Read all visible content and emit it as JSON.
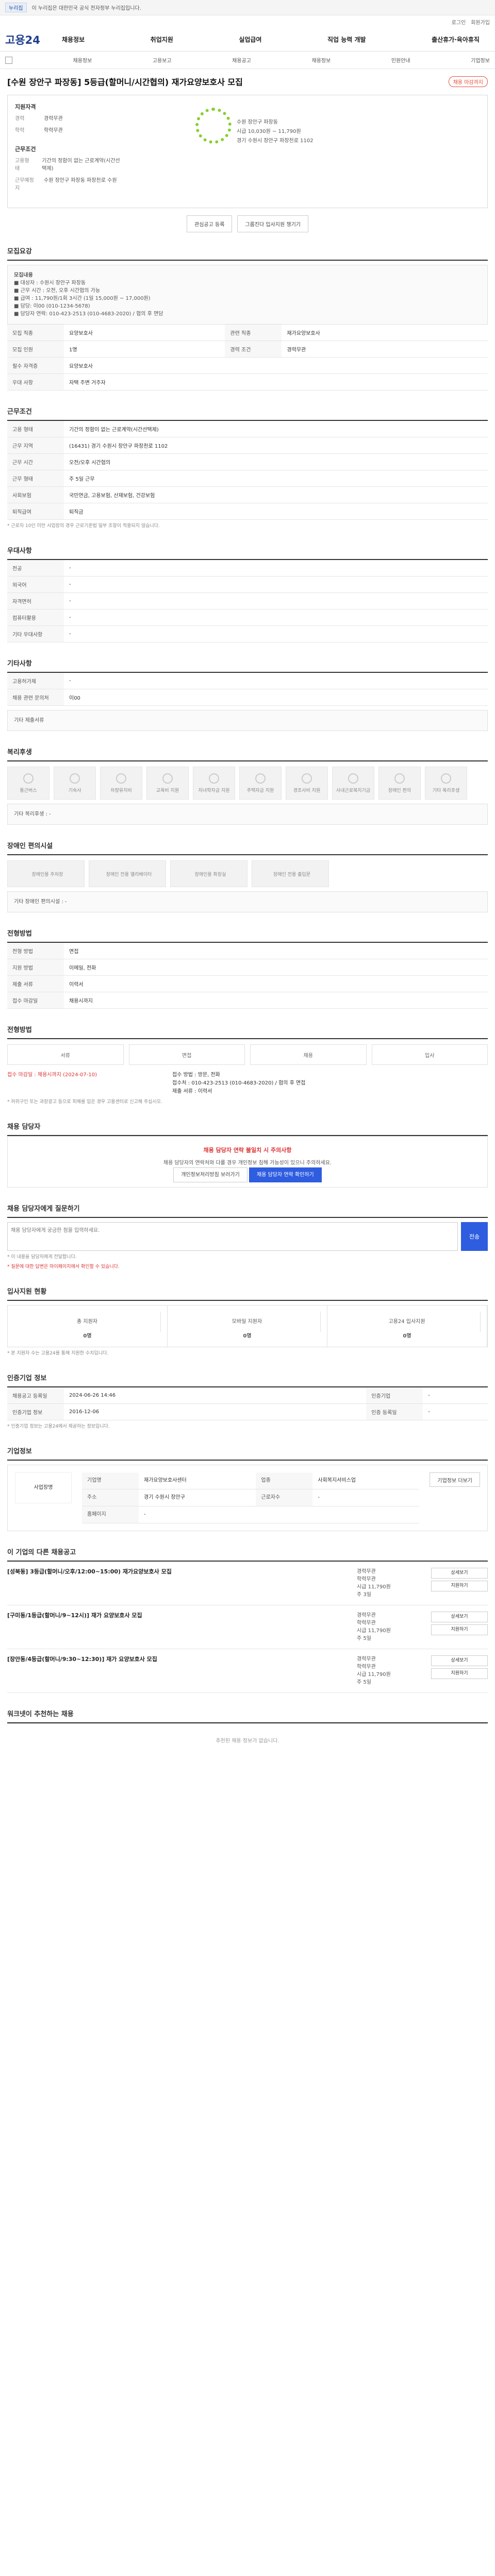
{
  "gov": {
    "text": "이 누리집은 대한민국 공식 전자정부 누리집입니다.",
    "tag": "누리집"
  },
  "util": [
    "로그인",
    "회원가입"
  ],
  "brand": "고용24",
  "nav": [
    "채용정보",
    "취업지원",
    "실업급여",
    "직업 능력 개발",
    "출산휴가·육아휴직"
  ],
  "subnav": [
    "채용정보",
    "고용보고",
    "채용공고",
    "채용정보",
    "민원안내",
    "기업정보"
  ],
  "title": "[수원 장안구 파장동] 5등급(할머니/시간협의) 재가요양보호사 모집",
  "badge": "채용 마감까지",
  "summary": {
    "recruit_title": "지원자격",
    "rows": [
      [
        "경력",
        "경력무관"
      ],
      [
        "학력",
        "학력무관"
      ]
    ],
    "cond_title": "근무조건",
    "cond": [
      [
        "고용형태",
        "기간의 정함이 없는 근로계약(시간선택제)"
      ],
      [
        "근무예정지",
        "수원 장안구 파장동 파장천로 수원"
      ]
    ],
    "company": "수원 장안구 파장동",
    "pay": "시급 10,030원 ~ 11,790원",
    "loc": "경기 수원시 장안구 파장천로 1102"
  },
  "actions": [
    "관심공고 등록",
    "그룹진다 입사지원 챙기기"
  ],
  "sec1": {
    "title": "모집요강",
    "box": [
      "모집내용",
      "■ 대상자 : 수원시 장안구 파장동",
      "■ 근무 시간 : 오전, 오후 시간협의 가능",
      "■ 급여 : 11,790원/1회 3시간 (1일 15,000원 ~ 17,000원)",
      "■ 담당: 이00 (010-1234-5678)",
      "■ 담당자 연락: 010-423-2513 (010-4683-2020) / 협의 후 면담"
    ],
    "rows": [
      [
        "모집 직종",
        "요양보호사",
        "관련 직종",
        "재가요양보호사"
      ],
      [
        "모집 인원",
        "1명",
        "경력 조건",
        "경력무관"
      ],
      [
        "필수 자격증",
        "요양보호사",
        "",
        ""
      ],
      [
        "우대 사항",
        "자택 주변 거주자",
        "",
        ""
      ]
    ]
  },
  "sec2": {
    "title": "근무조건",
    "rows": [
      [
        "고용 형태",
        "기간의 정함이 없는 근로계약(시간선택제)"
      ],
      [
        "근무 지역",
        "(16431) 경기 수원시 장안구 파장천로 1102"
      ],
      [
        "근무 시간",
        "오전/오후 시간협의"
      ],
      [
        "근무 형태",
        "주 5일 근무"
      ],
      [
        "사회보험",
        "국민연금, 고용보험, 산재보험, 건강보험"
      ],
      [
        "퇴직급여",
        "퇴직금"
      ]
    ],
    "note": "* 근로자 10인 미만 사업장의 경우 근로기준법 일부 조항이 적용되지 않습니다."
  },
  "sec3": {
    "title": "우대사항",
    "rows": [
      [
        "전공",
        "-"
      ],
      [
        "외국어",
        "-"
      ],
      [
        "자격면허",
        "-"
      ],
      [
        "컴퓨터활용",
        "-"
      ],
      [
        "기타 우대사항",
        "-"
      ]
    ]
  },
  "sec4": {
    "title": "기타사항",
    "rows": [
      [
        "고용허가제",
        "-"
      ],
      [
        "채용 관련 문의처",
        "이00"
      ]
    ],
    "extra": "기타 제출서류"
  },
  "sec5": {
    "title": "복리후생",
    "items": [
      "통근버스",
      "기숙사",
      "차량유지비",
      "교육비 지원",
      "자녀학자금 지원",
      "주택자금 지원",
      "경조사비 지원",
      "사내근로복지기금",
      "장애인 편의",
      "기타 복리후생"
    ],
    "etc": "기타 복리후생 : -"
  },
  "sec6": {
    "title": "장애인 편의시설",
    "items": [
      "장애인용 주차장",
      "장애인 전용 엘리베이터",
      "장애인용 화장실",
      "장애인 전용 출입문"
    ],
    "etc": "기타 장애인 편의시설 : -"
  },
  "sec7": {
    "title": "전형방법",
    "rows": [
      [
        "전형 방법",
        "면접"
      ],
      [
        "지원 방법",
        "이메일, 전화"
      ],
      [
        "제출 서류",
        "이력서"
      ],
      [
        "접수 마감일",
        "채용시까지"
      ]
    ]
  },
  "sec8": {
    "title": "전형방법",
    "steps": [
      "서류",
      "면접",
      "채용",
      "입사"
    ],
    "apply_left": "접수 마감일 : 채용시까지 (2024-07-10)",
    "apply_right": [
      "접수 방법 : 방문, 전화",
      "접수처 : 010-423-2513 (010-4683-2020) / 협의 후 면접",
      "제출 서류 : 이력서"
    ],
    "note": "* 허위구인 또는 과장광고 등으로 피해를 입은 경우 고용센터로 신고해 주십시오."
  },
  "sec9": {
    "title": "채용 담당자",
    "warn": "채용 담당자 연락 불일치 시 주의사항",
    "desc": "채용 담당자의 연락처와 다를 경우 개인정보 침해 가능성이 있으니 주의하세요.",
    "btns": [
      "개인정보처리방침 보러가기",
      "채용 담당자 연락 확인하기"
    ]
  },
  "sec10": {
    "title": "채용 담당자에게 질문하기",
    "placeholder": "채용 담당자에게 궁금한 점을 입력하세요.",
    "send": "전송",
    "notes": [
      "* 이 내용을 담당자에게 전달합니다.",
      "* 질문에 대한 답변은 마이페이지에서 확인할 수 있습니다."
    ]
  },
  "sec11": {
    "title": "입사지원 현황",
    "stats": [
      [
        "총 지원자",
        "0명"
      ],
      [
        "모바일 지원자",
        "0명"
      ],
      [
        "고용24 입사지원",
        "0명"
      ]
    ],
    "note": "* 본 지원자 수는 고용24를 통해 지원한 수치입니다."
  },
  "sec12": {
    "title": "인증기업 정보",
    "rows": [
      [
        "채용공고 등록일",
        "2024-06-26 14:46",
        "인증기업",
        "-"
      ],
      [
        "인증기업 정보",
        "2016-12-06",
        "인증 등록일",
        "-"
      ]
    ],
    "note": "* 인증기업 정보는 고용24에서 제공하는 정보입니다."
  },
  "sec13": {
    "title": "기업정보",
    "name": "사업장명",
    "rows": [
      [
        "기업명",
        "재가요양보호사센터",
        "업종",
        "사회복지서비스업"
      ],
      [
        "주소",
        "경기 수원시 장안구",
        "근로자수",
        "-"
      ],
      [
        "홈페이지",
        "-",
        "",
        ""
      ]
    ],
    "btn": "기업정보 더보기"
  },
  "sec14": {
    "title": "이 기업의 다른 채용공고",
    "jobs": [
      {
        "title": "[성북동] 3등급(할머니/오후/12:00~15:00) 재가요양보호사 모집",
        "c": [
          "경력무관",
          "학력무관",
          "시급 11,790원",
          "주 3일"
        ]
      },
      {
        "title": "[구미동/1등급(할머니/9~12시)] 재가 요양보호사 모집",
        "c": [
          "경력무관",
          "학력무관",
          "시급 11,790원",
          "주 5일"
        ]
      },
      {
        "title": "[장안동/4등급(할머니/9:30~12:30)] 재가 요양보호사 모집",
        "c": [
          "경력무관",
          "학력무관",
          "시급 11,790원",
          "주 5일"
        ]
      }
    ],
    "act": [
      "상세보기",
      "지원하기"
    ]
  },
  "sec15": {
    "title": "워크넷이 추천하는 채용",
    "empty": "추천된 채용 정보가 없습니다."
  },
  "colors": {
    "brand": "#1f3f8f",
    "accent": "#2f5de0",
    "alert": "#d33"
  }
}
